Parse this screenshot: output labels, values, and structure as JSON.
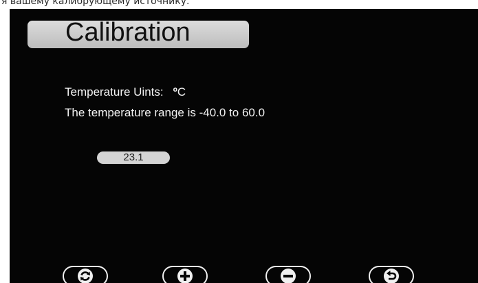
{
  "caption": "я вашему калибрующему источнику.",
  "screen": {
    "title": "Calibration",
    "temperature_units": {
      "label": "Temperature Uints:",
      "value_symbol": "º",
      "value_unit": "C"
    },
    "range_text": "The temperature range is -40.0 to 60.0",
    "current_value": "23.1"
  },
  "softkeys": [
    {
      "icon": "refresh-icon"
    },
    {
      "icon": "plus-icon"
    },
    {
      "icon": "minus-icon"
    },
    {
      "icon": "return-icon"
    }
  ],
  "colors": {
    "screen_background": "#050505",
    "screen_text": "#f2f2f2",
    "pill_background": "#d4d4d4"
  }
}
